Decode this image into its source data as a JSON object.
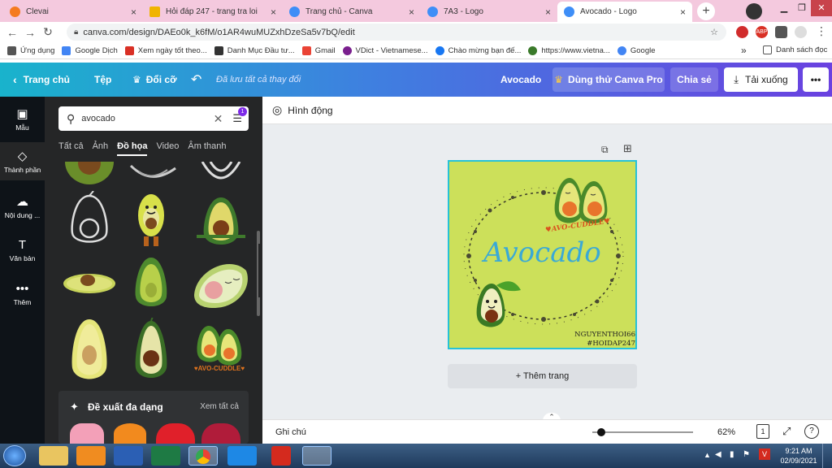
{
  "browser": {
    "tabs": [
      {
        "title": "Clevai",
        "favicon_color": "#f47b20"
      },
      {
        "title": "Hỏi đáp 247 - trang tra loi",
        "favicon_color": "#f0b400"
      },
      {
        "title": "Trang chủ - Canva",
        "favicon_color": "#3e8ef7"
      },
      {
        "title": "7A3 - Logo",
        "favicon_color": "#3e8ef7"
      },
      {
        "title": "Avocado - Logo",
        "favicon_color": "#3e8ef7"
      }
    ],
    "tab_close": "×",
    "new_tab": "+",
    "url": "canva.com/design/DAEo0k_k6fM/o1AR4wuMUZxhDzeSa5v7bQ/edit",
    "bookmarks": [
      {
        "label": "Ứng dụng",
        "color": "#555"
      },
      {
        "label": "Google Dịch",
        "color": "#4285f4"
      },
      {
        "label": "Xem ngày tốt theo...",
        "color": "#d93025"
      },
      {
        "label": "Danh Mục Đầu tư...",
        "color": "#333"
      },
      {
        "label": "Gmail",
        "color": "#ea4335"
      },
      {
        "label": "VDict - Vietnamese...",
        "color": "#7a1f8e"
      },
      {
        "label": "Chào mừng bạn đế...",
        "color": "#1877f2"
      },
      {
        "label": "https://www.vietna...",
        "color": "#3a7a2a"
      },
      {
        "label": "Google",
        "color": "#4285f4"
      }
    ],
    "bookmarks_more": "»",
    "reading_list": "Danh sách đọc"
  },
  "canva_header": {
    "back": "Trang chủ",
    "file": "Tệp",
    "resize": "Đổi cỡ",
    "undo_icon": "undo-icon",
    "saved": "Đã lưu tất cả thay đổi",
    "design_title": "Avocado",
    "try_pro": "Dùng thử Canva Pro",
    "share": "Chia sẻ",
    "download": "Tải xuống",
    "more": "•••"
  },
  "left_rail": [
    {
      "label": "Mẫu",
      "icon": "▣"
    },
    {
      "label": "Thành phần",
      "icon": "◇"
    },
    {
      "label": "Nội dung ...",
      "icon": "☁"
    },
    {
      "label": "Văn bản",
      "icon": "T"
    },
    {
      "label": "Thêm",
      "icon": "•••"
    }
  ],
  "side_panel": {
    "search_value": "avocado",
    "filter_badge": "1",
    "tabs": [
      "Tất cả",
      "Ảnh",
      "Đồ họa",
      "Video",
      "Âm thanh"
    ],
    "active_tab": "Đồ họa",
    "suggest_title": "Đề xuất đa dạng",
    "see_all": "Xem tất cả",
    "graphic_label": "♥AVO-CUDDLE♥"
  },
  "toolbar": {
    "animate": "Hình động"
  },
  "design": {
    "title": "Avocado",
    "badge": "♥AVO-CUDDLE♥",
    "credit_line1": "NGUYENTHOI66",
    "credit_line2": "#HOIDAP247",
    "add_page": "+ Thêm trang",
    "bg_color": "#cce05a",
    "title_color": "#3aa9d6"
  },
  "footer": {
    "notes": "Ghi chú",
    "zoom": "62%",
    "page_num": "1",
    "help": "?"
  },
  "taskbar": {
    "time": "9:21 AM",
    "date": "02/09/2021"
  }
}
